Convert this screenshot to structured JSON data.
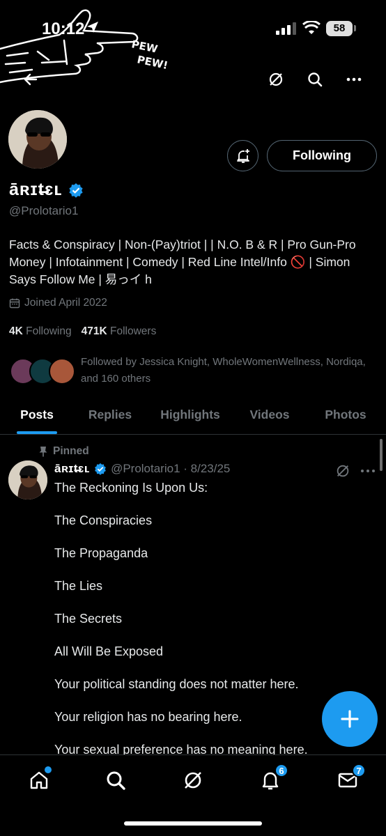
{
  "status_bar": {
    "time": "10:12",
    "battery": "58"
  },
  "banner": {
    "text_line1": "PEW",
    "text_line2": "PEW!"
  },
  "profile": {
    "follow_button": "Following",
    "name": "ā̄ʀɪt̶ɛʟ",
    "handle": "@Prolotario1",
    "bio": "Facts & Conspiracy | Non-(Pay)triot | | N.O. B & R | Pro Gun-Pro Money | Infotainment | Comedy | Red Line Intel/Info 🚫 | Simon Says Follow Me | 易っイ h",
    "joined": "Joined April 2022",
    "following_count": "4K",
    "following_label": "Following",
    "followers_count": "471K",
    "followers_label": "Followers",
    "followed_by": "Followed by Jessica Knight, WholeWomenWellness, Nordiqa, and 160 others"
  },
  "tabs": [
    "Posts",
    "Replies",
    "Highlights",
    "Videos",
    "Photos"
  ],
  "active_tab": "Posts",
  "post": {
    "pinned_label": "Pinned",
    "author_name": "ā̄ʀɪt̶ɛʟ",
    "meta": "@Prolotario1 · 8/23/25",
    "lines": [
      "The Reckoning Is Upon Us:",
      "The Conspiracies",
      "The Propaganda",
      "The Lies",
      "The Secrets",
      "All  Will Be Exposed",
      "Your political standing does not matter here.",
      "Your religion has no bearing here.",
      "Your sexual preference has no meaning here."
    ]
  },
  "bottom_nav": {
    "notifications_badge": "6",
    "messages_badge": "7"
  },
  "colors": {
    "accent": "#1d9bf0",
    "muted": "#71767b",
    "border": "#2f3336"
  },
  "icons": [
    "back-arrow-icon",
    "grok-icon",
    "search-icon",
    "more-icon",
    "bell-plus-icon",
    "verified-icon",
    "calendar-icon",
    "pin-icon",
    "plus-icon",
    "home-icon",
    "bell-icon",
    "mail-icon"
  ]
}
